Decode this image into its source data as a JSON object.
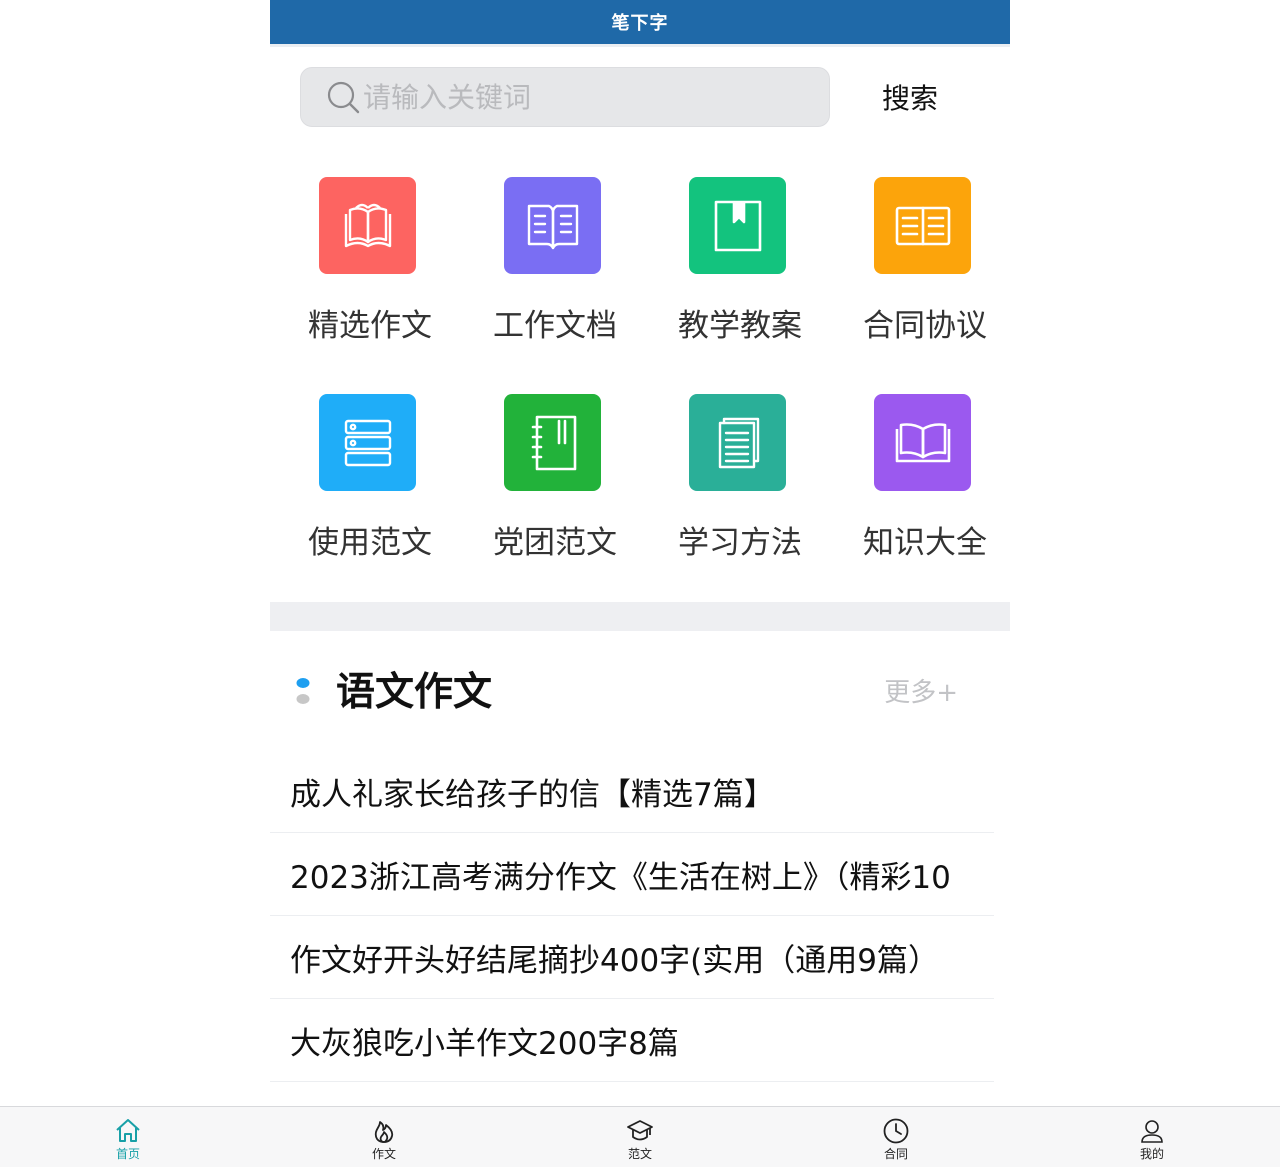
{
  "header": {
    "title": "笔下字"
  },
  "search": {
    "placeholder": "请输入关键词",
    "value": "",
    "button_label": "搜索"
  },
  "categories": [
    {
      "label": "精选作文",
      "icon": "open-book-icon",
      "color": "#fd6461"
    },
    {
      "label": "工作文档",
      "icon": "book-pages-icon",
      "color": "#7a6ef3"
    },
    {
      "label": "教学教案",
      "icon": "bookmark-book-icon",
      "color": "#13c37e"
    },
    {
      "label": "合同协议",
      "icon": "open-document-icon",
      "color": "#fca40b"
    },
    {
      "label": "使用范文",
      "icon": "server-list-icon",
      "color": "#1fadf8"
    },
    {
      "label": "党团范文",
      "icon": "notebook-icon",
      "color": "#22b23a"
    },
    {
      "label": "学习方法",
      "icon": "document-stack-icon",
      "color": "#2aaf98"
    },
    {
      "label": "知识大全",
      "icon": "wide-book-icon",
      "color": "#9b59ef"
    }
  ],
  "section": {
    "title": "语文作文",
    "more_label": "更多+",
    "dot_colors": {
      "top": "#1e9ff0",
      "bottom": "#c7c7c7"
    }
  },
  "articles": [
    {
      "title": "成人礼家长给孩子的信【精选7篇】"
    },
    {
      "title": "2023浙江高考满分作文《生活在树上》（精彩10"
    },
    {
      "title": "作文好开头好结尾摘抄400字(实用（通用9篇）"
    },
    {
      "title": "大灰狼吃小羊作文200字8篇"
    }
  ],
  "bottom_nav": [
    {
      "label": "首页",
      "icon": "home-icon",
      "active": true
    },
    {
      "label": "作文",
      "icon": "flame-icon",
      "active": false
    },
    {
      "label": "范文",
      "icon": "graduation-cap-icon",
      "active": false
    },
    {
      "label": "合同",
      "icon": "clock-icon",
      "active": false
    },
    {
      "label": "我的",
      "icon": "user-icon",
      "active": false
    }
  ],
  "colors": {
    "header_bg": "#1f69a8",
    "nav_active": "#18a0a7"
  }
}
